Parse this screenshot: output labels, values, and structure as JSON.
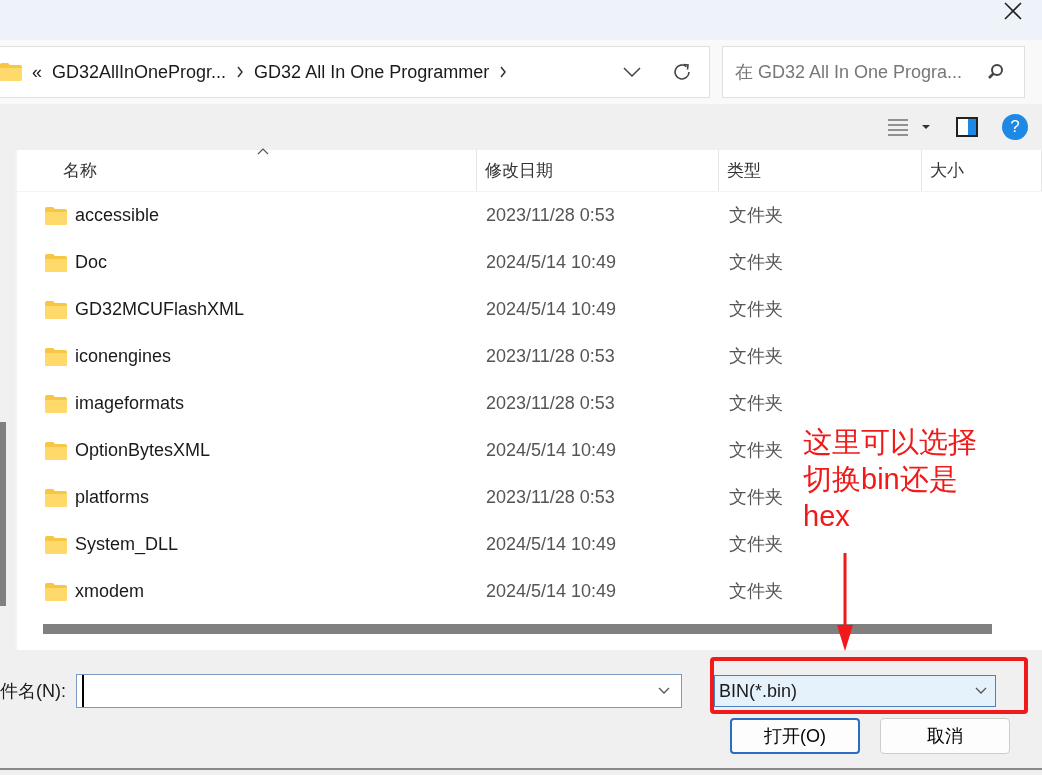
{
  "breadcrumb": {
    "overflow": "«",
    "items": [
      "GD32AllInOneProgr...",
      "GD32 All In One Programmer"
    ]
  },
  "search": {
    "placeholder": "在 GD32 All In One Progra..."
  },
  "columns": [
    {
      "label": "名称",
      "sorted": true
    },
    {
      "label": "修改日期",
      "sorted": false
    },
    {
      "label": "类型",
      "sorted": false
    },
    {
      "label": "大小",
      "sorted": false
    }
  ],
  "rows": [
    {
      "name": "accessible",
      "modified": "2023/11/28 0:53",
      "type": "文件夹"
    },
    {
      "name": "Doc",
      "modified": "2024/5/14 10:49",
      "type": "文件夹"
    },
    {
      "name": "GD32MCUFlashXML",
      "modified": "2024/5/14 10:49",
      "type": "文件夹"
    },
    {
      "name": "iconengines",
      "modified": "2023/11/28 0:53",
      "type": "文件夹"
    },
    {
      "name": "imageformats",
      "modified": "2023/11/28 0:53",
      "type": "文件夹"
    },
    {
      "name": "OptionBytesXML",
      "modified": "2024/5/14 10:49",
      "type": "文件夹"
    },
    {
      "name": "platforms",
      "modified": "2023/11/28 0:53",
      "type": "文件夹"
    },
    {
      "name": "System_DLL",
      "modified": "2024/5/14 10:49",
      "type": "文件夹"
    },
    {
      "name": "xmodem",
      "modified": "2024/5/14 10:49",
      "type": "文件夹"
    }
  ],
  "toolbar": {
    "help": "?"
  },
  "file_name": {
    "label": "件名(N):"
  },
  "file_type": {
    "value": "BIN(*.bin)"
  },
  "buttons": [
    {
      "label": "打开(O)",
      "default": true
    },
    {
      "label": "取消",
      "default": false
    }
  ],
  "annotation": {
    "text": "这里可以选择切换bin还是hex"
  }
}
